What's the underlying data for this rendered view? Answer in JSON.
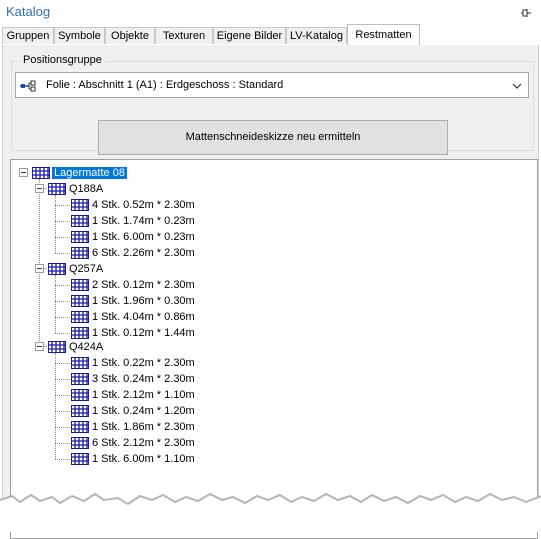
{
  "window": {
    "title": "Katalog",
    "pin_icon": "pin-icon"
  },
  "tabs": [
    {
      "label": "Gruppen"
    },
    {
      "label": "Symbole"
    },
    {
      "label": "Objekte"
    },
    {
      "label": "Texturen"
    },
    {
      "label": "Eigene Bilder"
    },
    {
      "label": "LV-Katalog"
    },
    {
      "label": "Restmatten",
      "active": true
    }
  ],
  "positionsgruppe": {
    "label": "Positionsgruppe",
    "selected": "Folie : Abschnitt 1 (A1) : Erdgeschoss : Standard"
  },
  "action_button": "Mattenschneideskizze neu ermitteln",
  "tree": {
    "root": "Lagermatte 08",
    "groups": [
      {
        "name": "Q188A",
        "items": [
          "4 Stk. 0.52m * 2.30m",
          "1 Stk. 1.74m * 0.23m",
          "1 Stk. 6.00m * 0.23m",
          "6 Stk. 2.26m * 2.30m"
        ]
      },
      {
        "name": "Q257A",
        "items": [
          "2 Stk. 0.12m * 2.30m",
          "1 Stk. 1.96m * 0.30m",
          "1 Stk. 4.04m * 0.86m",
          "1 Stk. 0.12m * 1.44m"
        ]
      },
      {
        "name": "Q424A",
        "items": [
          "1 Stk. 0.22m * 2.30m",
          "3 Stk. 0.24m * 2.30m",
          "1 Stk. 2.12m * 1.10m",
          "1 Stk. 0.24m * 1.20m",
          "1 Stk. 1.86m * 2.30m",
          "6 Stk. 2.12m * 2.30m",
          "1 Stk. 6.00m * 1.10m"
        ]
      }
    ]
  },
  "colors": {
    "selection": "#0078d7",
    "title": "#2b6fb3",
    "mat_icon": "#1a1aa6"
  }
}
